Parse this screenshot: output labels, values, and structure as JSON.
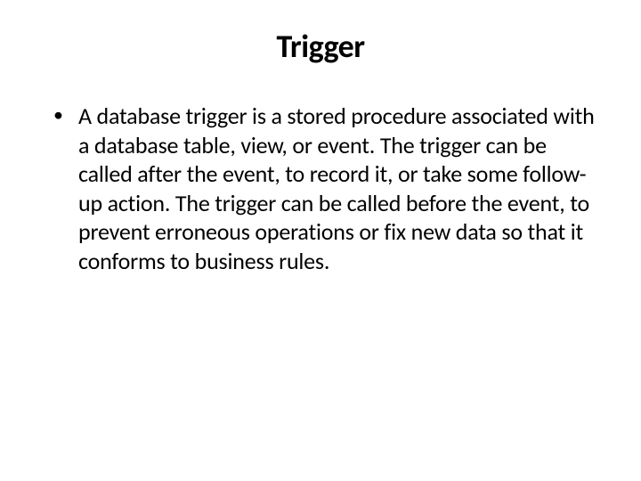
{
  "slide": {
    "title": "Trigger",
    "bullets": [
      {
        "marker": "•",
        "text": "A database trigger is a stored procedure associated with a database table, view, or event. The trigger can be called after the event, to record it, or take some follow-up action. The trigger can be called before the event, to prevent erroneous operations or fix new data so that it conforms to business rules."
      }
    ]
  }
}
